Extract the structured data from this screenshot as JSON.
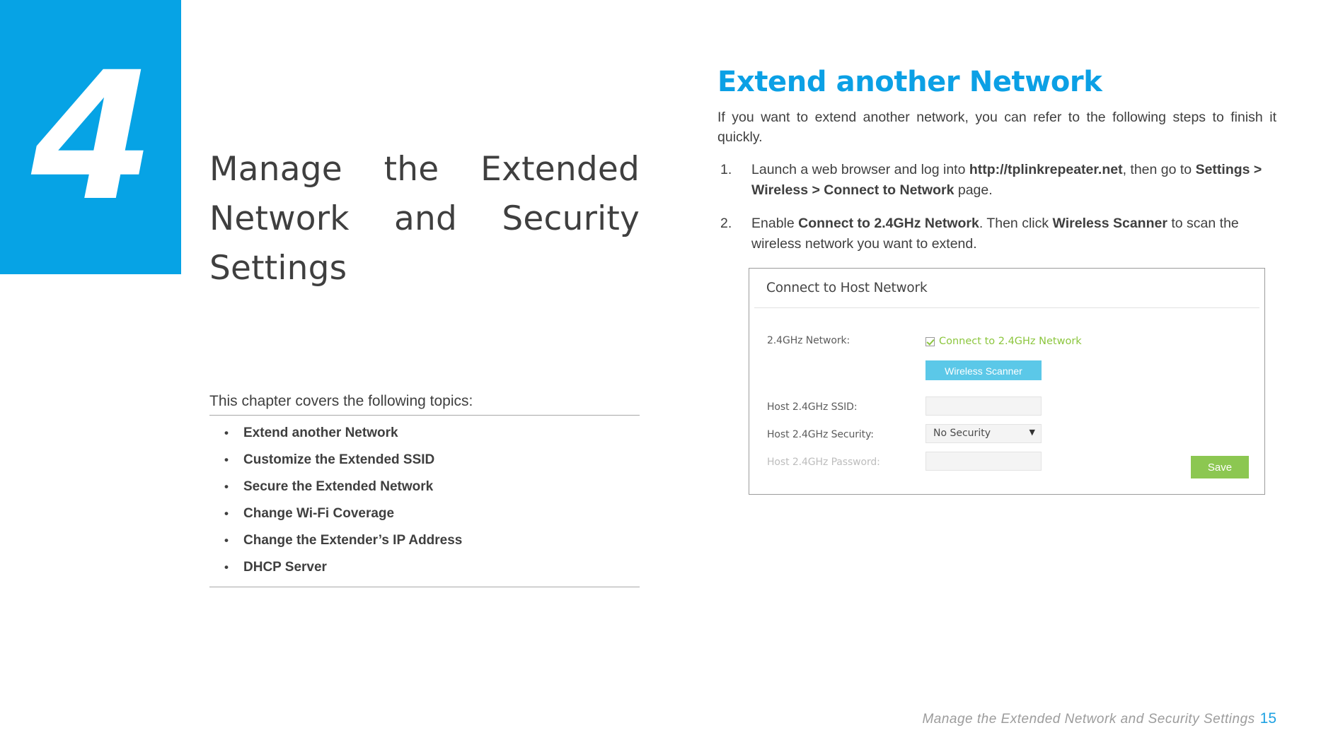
{
  "chapter": {
    "number": "4",
    "title": "Manage the Extended Network and Security Settings",
    "toc_intro": "This chapter covers the following topics:",
    "toc_items": [
      {
        "bullet": "•",
        "label": "Extend another Network"
      },
      {
        "bullet": "•",
        "label": "Customize the Extended SSID"
      },
      {
        "bullet": "•",
        "label": "Secure the Extended Network"
      },
      {
        "bullet": "•",
        "label": "Change Wi-Fi Coverage"
      },
      {
        "bullet": "•",
        "label": "Change the Extender’s IP Address"
      },
      {
        "bullet": "•",
        "label": "DHCP Server"
      }
    ]
  },
  "section": {
    "heading": "Extend another Network",
    "intro": "If you want to extend another network, you can refer to the following steps to finish it quickly.",
    "steps": [
      {
        "num": "1.",
        "part1": "Launch a web browser and log into ",
        "bold1": "http://tplinkrepeater.net",
        "part2": ", then go to ",
        "bold2": "Settings > Wireless > Connect to Network",
        "part3": " page."
      },
      {
        "num": "2.",
        "part1": "Enable ",
        "bold1": "Connect to 2.4GHz Network",
        "part2": ". Then click ",
        "bold2": "Wireless Scanner",
        "part3": " to scan the wireless network you want to extend."
      }
    ]
  },
  "ui_panel": {
    "title": "Connect to Host Network",
    "rows": {
      "network_label": "2.4GHz Network:",
      "checkbox_label": "Connect to 2.4GHz Network",
      "checkbox_checked": "checked",
      "scanner_button": "Wireless Scanner",
      "ssid_label": "Host 2.4GHz SSID:",
      "ssid_value": "",
      "security_label": "Host 2.4GHz Security:",
      "security_value": "No Security",
      "security_arrow": "▼",
      "password_label": "Host 2.4GHz Password:",
      "password_value": ""
    },
    "save_button": "Save",
    "colors": {
      "scanner_button_bg": "#5bc8e8",
      "save_button_bg": "#8cc751",
      "checkbox_accent": "#8cc63e"
    }
  },
  "footer": {
    "text": "Manage the Extended Network and Security Settings",
    "page_number": "15"
  },
  "theme": {
    "brand_blue": "#06A3E5",
    "heading_blue": "#0BA0E5",
    "page_number_blue": "#1EA1E2"
  }
}
